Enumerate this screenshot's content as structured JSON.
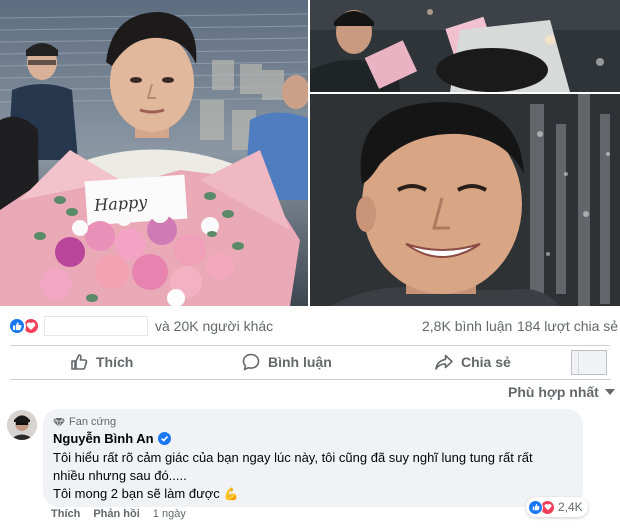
{
  "post": {
    "photos": [
      {
        "alt_name": "photo-young-man-holding-bouquet"
      },
      {
        "alt_name": "photo-people-holding-bouquets"
      },
      {
        "alt_name": "photo-smiling-young-man-closeup"
      }
    ],
    "bouquet_card_text": "Happy",
    "reactions": {
      "icons": [
        "like-icon",
        "love-icon"
      ],
      "others_text": "và 20K người khác",
      "comment_count": "2,8K bình luận",
      "share_count": "184 lượt chia sẻ"
    },
    "actions": {
      "like_label": "Thích",
      "comment_label": "Bình luận",
      "share_label": "Chia sẻ"
    },
    "sort_label": "Phù hợp nhất"
  },
  "comment": {
    "badge": "Fan cứng",
    "author": "Nguyễn Bình An",
    "lines": [
      "Tôi hiểu rất rõ cảm giác của bạn ngay lúc này, tôi cũng đã suy nghĩ lung tung rất rất",
      "nhiều nhưng sau đó.....",
      "Tôi mong 2 bạn sẽ làm được"
    ],
    "emoji": "💪",
    "reaction_count": "2,4K",
    "like_label": "Thích",
    "reply_label": "Phản hồi",
    "time": "1 ngày"
  },
  "colors": {
    "like_blue": "#1877f2",
    "love_red": "#f33e58",
    "secondary_text": "#65676b",
    "bubble_bg": "#f0f2f5"
  }
}
